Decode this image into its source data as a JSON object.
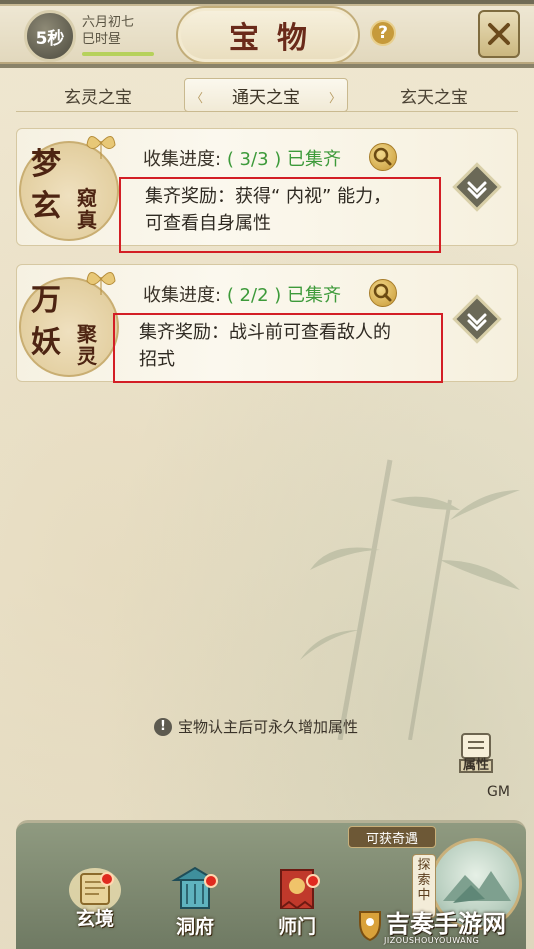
{
  "header": {
    "timer": "5秒",
    "date_line1": "六月初七",
    "date_line2": "巳时昼",
    "title": "宝物",
    "help_icon": "question-icon",
    "close_icon": "close-x-icon"
  },
  "tabs": [
    {
      "label": "玄灵之宝",
      "active": false
    },
    {
      "label": "通天之宝",
      "active": true
    },
    {
      "label": "玄天之宝",
      "active": false
    }
  ],
  "cards": [
    {
      "emblem_big": [
        "梦",
        "玄"
      ],
      "emblem_small": [
        "窥",
        "真"
      ],
      "progress_label": "收集进度:",
      "progress_value": "( 3/3 ) 已集齐",
      "reward_line1": "集齐奖励：获得“ 内视” 能力，",
      "reward_line2": "可查看自身属性"
    },
    {
      "emblem_big": [
        "万",
        "妖"
      ],
      "emblem_small": [
        "聚",
        "灵"
      ],
      "progress_label": "收集进度:",
      "progress_value": "( 2/2 ) 已集齐",
      "reward_line1": "集齐奖励：战斗前可查看敌人的",
      "reward_line2": "招式"
    }
  ],
  "notice": {
    "icon": "exclamation-icon",
    "text": "宝物认主后可永久增加属性"
  },
  "side": {
    "attr_label": "属性",
    "gm_label": "GM"
  },
  "bottom_nav": {
    "items": [
      {
        "label": "玄境",
        "icon": "scroll-icon"
      },
      {
        "label": "洞府",
        "icon": "pavilion-icon"
      },
      {
        "label": "师门",
        "icon": "banner-icon"
      }
    ],
    "chance_tag": "可获奇遇",
    "explore_badge": "探索中"
  },
  "watermark": {
    "main": "吉奏手游网",
    "sub": "JIZOUSHOUYOUWANG"
  },
  "colors": {
    "accent_green": "#3d9a3a",
    "highlight_red": "#d31e25",
    "title_brown": "#6a2a1a"
  }
}
